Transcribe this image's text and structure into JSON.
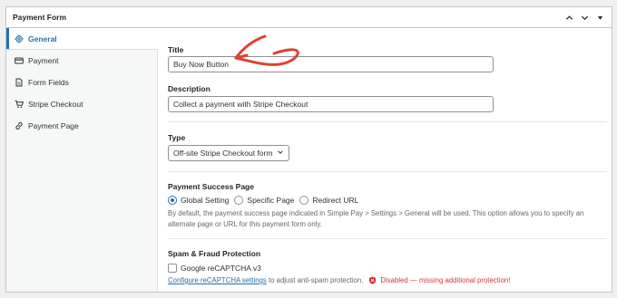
{
  "panel": {
    "title": "Payment Form"
  },
  "sidebar": {
    "items": [
      {
        "label": "General",
        "icon": "gear-icon",
        "active": true
      },
      {
        "label": "Payment",
        "icon": "credit-card-icon",
        "active": false
      },
      {
        "label": "Form Fields",
        "icon": "document-icon",
        "active": false
      },
      {
        "label": "Stripe Checkout",
        "icon": "cart-icon",
        "active": false
      },
      {
        "label": "Payment Page",
        "icon": "link-icon",
        "active": false
      }
    ]
  },
  "general": {
    "title_label": "Title",
    "title_value": "Buy Now Button",
    "description_label": "Description",
    "description_value": "Collect a payment with Stripe Checkout",
    "type_label": "Type",
    "type_value": "Off-site Stripe Checkout form",
    "success_label": "Payment Success Page",
    "success_options": [
      "Global Setting",
      "Specific Page",
      "Redirect URL"
    ],
    "success_selected": "Global Setting",
    "success_help_line1": "By default, the payment success page indicated in Simple Pay > Settings > General will be used. This option allows you to specify an",
    "success_help_line2": "alternate page or URL for this payment form only.",
    "spam_label": "Spam & Fraud Protection",
    "recaptcha_label": "Google reCAPTCHA v3",
    "configure_link": "Configure reCAPTCHA settings",
    "configure_suffix": " to adjust anti-spam protection.",
    "disabled_text": "Disabled — missing additional protection!"
  },
  "colors": {
    "accent": "#2271b1",
    "error": "#d63638",
    "annotation": "#e0402e"
  }
}
